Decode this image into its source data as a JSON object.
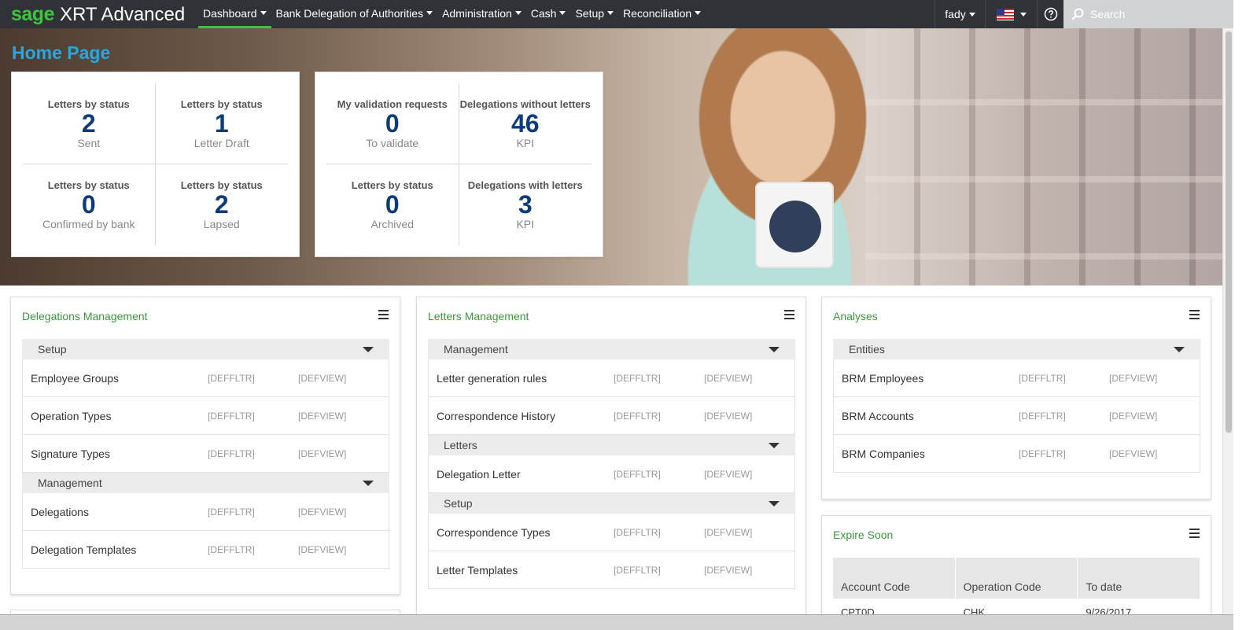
{
  "brand": {
    "sage": "sage",
    "product": "XRT Advanced"
  },
  "nav": {
    "items": [
      {
        "label": "Dashboard"
      },
      {
        "label": "Bank Delegation of Authorities"
      },
      {
        "label": "Administration"
      },
      {
        "label": "Cash"
      },
      {
        "label": "Setup"
      },
      {
        "label": "Reconciliation"
      }
    ],
    "active_index": 0,
    "user": "fady",
    "search_placeholder": "Search"
  },
  "colors": {
    "nav_bg": "#2f3237",
    "brand_green": "#3ec43c",
    "title_blue": "#29a7e1",
    "kpi_blue": "#0c3c7a",
    "widget_title": "#3a9a3a"
  },
  "hero": {
    "title": "Home Page",
    "card1": [
      {
        "title": "Letters by status",
        "value": "2",
        "sub": "Sent"
      },
      {
        "title": "Letters by status",
        "value": "1",
        "sub": "Letter Draft"
      },
      {
        "title": "Letters by status",
        "value": "0",
        "sub": "Confirmed by bank"
      },
      {
        "title": "Letters by status",
        "value": "2",
        "sub": "Lapsed"
      }
    ],
    "card2": [
      {
        "title": "My validation requests",
        "value": "0",
        "sub": "To validate"
      },
      {
        "title": "Delegations without letters",
        "value": "46",
        "sub": "KPI"
      },
      {
        "title": "Letters by status",
        "value": "0",
        "sub": "Archived"
      },
      {
        "title": "Delegations with letters",
        "value": "3",
        "sub": "KPI"
      }
    ]
  },
  "widgets": {
    "delegations": {
      "title": "Delegations Management",
      "groups": [
        {
          "name": "Setup",
          "rows": [
            {
              "name": "Employee Groups",
              "filter": "[DEFFLTR]",
              "view": "[DEFVIEW]"
            },
            {
              "name": "Operation Types",
              "filter": "[DEFFLTR]",
              "view": "[DEFVIEW]"
            },
            {
              "name": "Signature Types",
              "filter": "[DEFFLTR]",
              "view": "[DEFVIEW]"
            }
          ]
        },
        {
          "name": "Management",
          "rows": [
            {
              "name": "Delegations",
              "filter": "[DEFFLTR]",
              "view": "[DEFVIEW]"
            },
            {
              "name": "Delegation Templates",
              "filter": "[DEFFLTR]",
              "view": "[DEFVIEW]"
            }
          ]
        }
      ]
    },
    "letters": {
      "title": "Letters Management",
      "groups": [
        {
          "name": "Management",
          "rows": [
            {
              "name": "Letter generation rules",
              "filter": "[DEFFLTR]",
              "view": "[DEFVIEW]"
            },
            {
              "name": "Correspondence History",
              "filter": "[DEFFLTR]",
              "view": "[DEFVIEW]"
            }
          ]
        },
        {
          "name": "Letters",
          "rows": [
            {
              "name": "Delegation Letter",
              "filter": "[DEFFLTR]",
              "view": "[DEFVIEW]"
            }
          ]
        },
        {
          "name": "Setup",
          "rows": [
            {
              "name": "Correspondence Types",
              "filter": "[DEFFLTR]",
              "view": "[DEFVIEW]"
            },
            {
              "name": "Letter Templates",
              "filter": "[DEFFLTR]",
              "view": "[DEFVIEW]"
            }
          ]
        }
      ]
    },
    "analyses": {
      "title": "Analyses",
      "groups": [
        {
          "name": "Entities",
          "rows": [
            {
              "name": "BRM Employees",
              "filter": "[DEFFLTR]",
              "view": "[DEFVIEW]"
            },
            {
              "name": "BRM Accounts",
              "filter": "[DEFFLTR]",
              "view": "[DEFVIEW]"
            },
            {
              "name": "BRM Companies",
              "filter": "[DEFFLTR]",
              "view": "[DEFVIEW]"
            }
          ]
        }
      ]
    },
    "expire": {
      "title": "Expire Soon",
      "columns": [
        "Account Code",
        "Operation Code",
        "To date"
      ],
      "rows": [
        [
          "CPT0D",
          "CHK",
          "9/26/2017"
        ]
      ]
    }
  }
}
